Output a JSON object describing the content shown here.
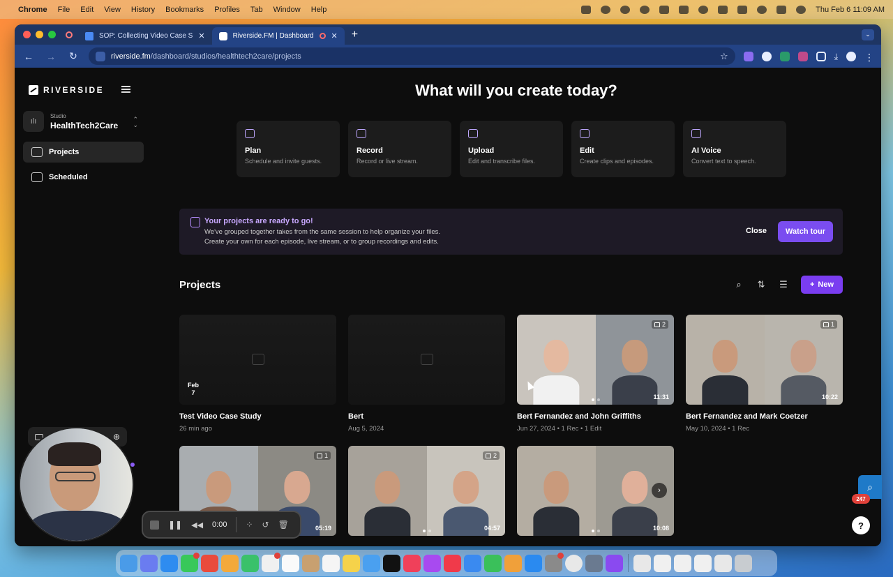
{
  "menubar": {
    "app": "Chrome",
    "items": [
      "File",
      "Edit",
      "View",
      "History",
      "Bookmarks",
      "Profiles",
      "Tab",
      "Window",
      "Help"
    ],
    "clock": "Thu Feb 6  11:09 AM"
  },
  "browser": {
    "tabs": [
      {
        "title": "SOP: Collecting Video Case S",
        "icon": "docs-icon",
        "active": false
      },
      {
        "title": "Riverside.FM | Dashboard",
        "icon": "riverside-icon",
        "active": true
      }
    ],
    "url_host": "riverside.fm",
    "url_path": "/dashboard/studios/healthtech2care/projects"
  },
  "sidebar": {
    "logo": "RIVERSIDE",
    "studio_label": "Studio",
    "studio_name": "HealthTech2Care",
    "items": [
      {
        "label": "Projects",
        "icon": "folder-icon",
        "active": true
      },
      {
        "label": "Scheduled",
        "icon": "calendar-icon",
        "active": false
      }
    ]
  },
  "main": {
    "hero_title": "What will you create today?",
    "actions": [
      {
        "title": "Plan",
        "subtitle": "Schedule and invite guests.",
        "icon": "calendar-icon"
      },
      {
        "title": "Record",
        "subtitle": "Record or live stream.",
        "icon": "video-plus-icon"
      },
      {
        "title": "Upload",
        "subtitle": "Edit and transcribe files.",
        "icon": "upload-icon"
      },
      {
        "title": "Edit",
        "subtitle": "Create clips and episodes.",
        "icon": "scissors-icon"
      },
      {
        "title": "AI Voice",
        "subtitle": "Convert text to speech.",
        "icon": "ai-voice-icon"
      }
    ],
    "banner": {
      "title": "Your projects are ready to go!",
      "line1": "We've grouped together takes from the same session to help organize your files.",
      "line2": "Create your own for each episode, live stream, or to group recordings and edits.",
      "close_label": "Close",
      "watch_label": "Watch tour"
    },
    "projects_title": "Projects",
    "new_label": "New",
    "projects": [
      {
        "title": "Test Video Case Study",
        "meta": "26 min ago",
        "thumb": "empty-calendar",
        "date_month": "Feb",
        "date_day": "7"
      },
      {
        "title": "Bert",
        "meta": "Aug 5, 2024",
        "thumb": "empty-folder"
      },
      {
        "title": "Bert Fernandez and John Griffiths",
        "meta": "Jun 27, 2024 • 1 Rec • 1 Edit",
        "thumb": "video",
        "count": "2",
        "duration": "11:31"
      },
      {
        "title": "Bert Fernandez and Mark Coetzer",
        "meta": "May 10, 2024 • 1 Rec",
        "thumb": "video",
        "count": "1",
        "duration": "10:22"
      },
      {
        "title": "",
        "meta": "",
        "thumb": "video",
        "count": "1",
        "duration": "05:19"
      },
      {
        "title": "",
        "meta": "",
        "thumb": "video",
        "count": "2",
        "duration": "04:57"
      },
      {
        "title": "",
        "meta": "",
        "thumb": "video",
        "count": "",
        "duration": "10:08"
      }
    ]
  },
  "recorder": {
    "time": "0:00"
  },
  "helper_count": "247",
  "colors": {
    "accent": "#7a3df0",
    "banner_title": "#c8a8ff",
    "chrome_frame": "#234385"
  }
}
